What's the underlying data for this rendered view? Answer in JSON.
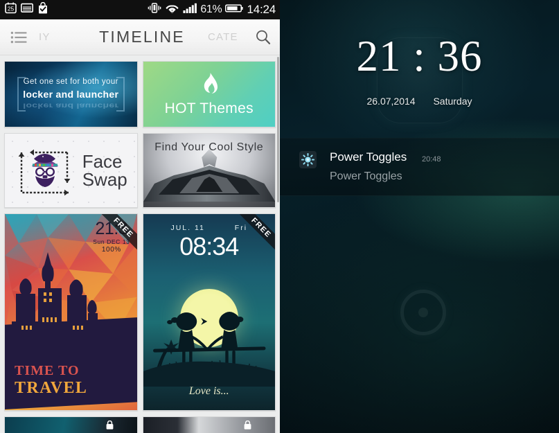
{
  "left_phone": {
    "statusbar": {
      "icons": [
        "calendar-25-icon",
        "screenshot-icon",
        "checked-bag-icon",
        "vibrate-icon",
        "wifi-icon",
        "signal-bars-icon"
      ],
      "calendar_day": "25",
      "battery_percent": "61%",
      "clock": "14:24"
    },
    "toolbar": {
      "menu_icon": "list-menu-icon",
      "tab_my": "IY",
      "tab_timeline": "TIMELINE",
      "tab_category": "CATE",
      "search_icon": "search-icon"
    },
    "cards": {
      "banner_locker": {
        "line1": "Get one set for both your",
        "line2": "locker and launcher"
      },
      "banner_hot": {
        "label": "HOT Themes",
        "icon": "flame-icon"
      },
      "banner_face": {
        "line1": "Face",
        "line2": "Swap",
        "icon": "face-swap-icon"
      },
      "banner_cool": {
        "title": "Find Your Cool Style"
      },
      "theme_travel": {
        "time": "21:3",
        "date": "Sun DEC 13",
        "battery": "100%",
        "caption_line1": "TIME TO",
        "caption_line2": "TRAVEL",
        "badge": "FREE"
      },
      "theme_love": {
        "date": "JUL. 11",
        "weekday": "Fri",
        "time": "08:34",
        "caption": "Love is...",
        "badge": "FREE"
      },
      "partial_left": {
        "icon": "lock-icon"
      },
      "partial_right": {
        "icon": "lock-icon"
      }
    }
  },
  "right_phone": {
    "lockscreen": {
      "clock": "21 : 36",
      "date": "26.07,2014",
      "weekday": "Saturday",
      "unlock_ring": "unlock-ring-icon",
      "notification": {
        "icon": "power-toggles-gear-icon",
        "title": "Power Toggles",
        "time": "20:48",
        "subtitle": "Power Toggles"
      }
    }
  },
  "colors": {
    "statusbar_bg": "#101010",
    "toolbar_bg": "#f5f5f5",
    "toolbar_title": "#464646",
    "toolbar_tab_inactive": "#cfcfcf",
    "page_bg": "#eceded",
    "hot_gradient_start": "#9fd985",
    "hot_gradient_end": "#4fcfc4",
    "notif_icon_accent": "#7fd8ef",
    "lockscreen_bg": "#05171d"
  }
}
